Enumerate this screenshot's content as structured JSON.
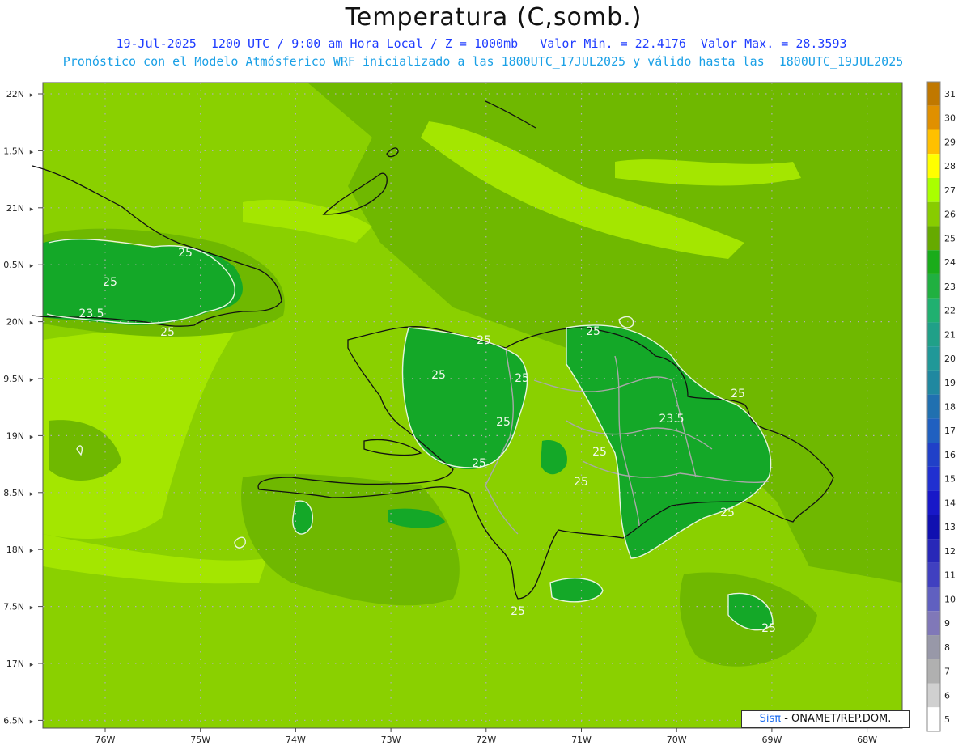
{
  "header": {
    "title": "Temperatura (C,somb.)",
    "line1": "19-Jul-2025  1200 UTC / 9:00 am Hora Local / Z = 1000mb   Valor Min. = 22.4176  Valor Max. = 28.3593",
    "line2": "Pronóstico con el Modelo Atmósferico WRF inicializado a las 1800UTC_17JUL2025 y válido hasta las  1800UTC_19JUL2025"
  },
  "axes": {
    "lat_labels": [
      "22N",
      "1.5N",
      "21N",
      "0.5N",
      "20N",
      "9.5N",
      "19N",
      "8.5N",
      "18N",
      "7.5N",
      "17N",
      "6.5N"
    ],
    "lon_labels": [
      "76W",
      "75W",
      "74W",
      "73W",
      "72W",
      "71W",
      "70W",
      "69W",
      "68W"
    ]
  },
  "contour_labels": [
    "25",
    "25",
    "23.5",
    "25",
    "25",
    "25",
    "25",
    "25",
    "25",
    "25",
    "25",
    "25",
    "25",
    "23.5",
    "25",
    "25",
    "25"
  ],
  "colorbar": {
    "labels": [
      "31",
      "30",
      "29",
      "28",
      "27",
      "26",
      "25",
      "24",
      "23",
      "22",
      "21",
      "20",
      "19",
      "18",
      "17",
      "16",
      "15",
      "14",
      "13",
      "12",
      "11",
      "10",
      "9",
      "8",
      "7",
      "6",
      "5"
    ],
    "colors": [
      "#c07800",
      "#e09000",
      "#ffc000",
      "#ffff00",
      "#aaff00",
      "#88cc00",
      "#66aa00",
      "#1aac1a",
      "#20b040",
      "#20b070",
      "#20a088",
      "#209898",
      "#2088a0",
      "#2070b0",
      "#2060c0",
      "#2040c8",
      "#2030d0",
      "#1818c8",
      "#1010b0",
      "#2828b8",
      "#4040c0",
      "#6060c0",
      "#8078b8",
      "#9898a8",
      "#b0b0b0",
      "#d0d0d0",
      "#ffffff"
    ]
  },
  "credit": {
    "brand": "SisPI",
    "brand_display": "Sisπ",
    "text": " - ONAMET/REP.DOM."
  },
  "colors": {
    "base_field": "#8ad000",
    "light_field": "#a4e600",
    "mid_field": "#6fb800",
    "warm_field": "#14a828",
    "cool_field": "#18b034",
    "coast": "#111111",
    "borders": "#a8a8a8"
  }
}
